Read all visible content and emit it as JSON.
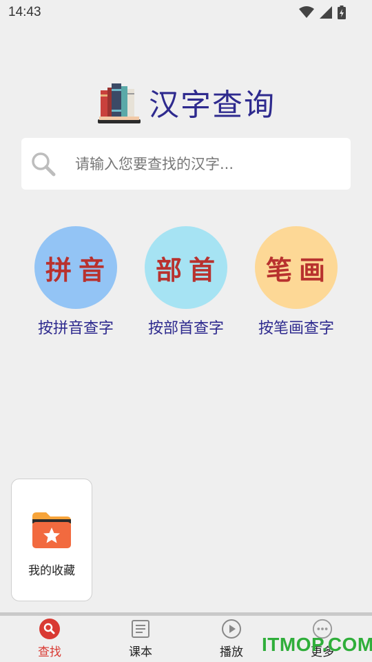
{
  "status_bar": {
    "time": "14:43"
  },
  "header": {
    "title": "汉字查询",
    "logo_icon": "books-icon"
  },
  "search": {
    "placeholder": "请输入您要查找的汉字...",
    "value": ""
  },
  "categories": [
    {
      "circle_text": "拼音",
      "label": "按拼音查字",
      "color": "#93c4f5"
    },
    {
      "circle_text": "部首",
      "label": "按部首查字",
      "color": "#a6e3f3"
    },
    {
      "circle_text": "笔画",
      "label": "按笔画查字",
      "color": "#fdd896"
    }
  ],
  "favorites": {
    "label": "我的收藏",
    "icon": "star-folder-icon"
  },
  "bottom_nav": [
    {
      "label": "查找",
      "icon": "search-icon",
      "active": true
    },
    {
      "label": "课本",
      "icon": "document-icon",
      "active": false
    },
    {
      "label": "播放",
      "icon": "play-icon",
      "active": false
    },
    {
      "label": "更多",
      "icon": "more-icon",
      "active": false
    }
  ],
  "watermark": "ITMOP.COM",
  "colors": {
    "background": "#efefef",
    "title": "#2e2a8e",
    "circle_text": "#b8312e",
    "active_nav": "#d93a33",
    "watermark": "#2fae3a"
  }
}
